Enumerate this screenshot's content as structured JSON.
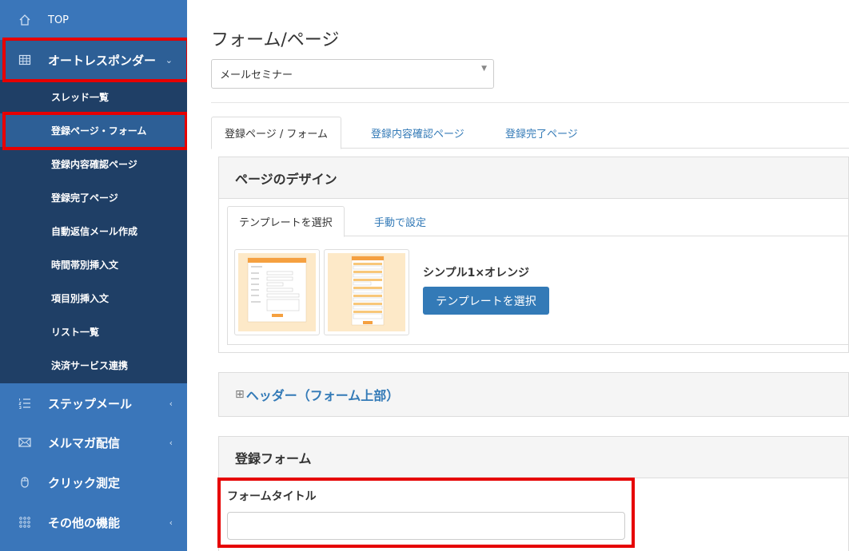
{
  "sidebar": {
    "top_label": "TOP",
    "autoresponder": "オートレスポンダー",
    "submenu": [
      "スレッド一覧",
      "登録ページ・フォーム",
      "登録内容確認ページ",
      "登録完了ページ",
      "自動返信メール作成",
      "時間帯別挿入文",
      "項目別挿入文",
      "リスト一覧",
      "決済サービス連携"
    ],
    "items": [
      {
        "label": "ステップメール",
        "icon": "list-icon"
      },
      {
        "label": "メルマガ配信",
        "icon": "envelope-icon"
      },
      {
        "label": "クリック測定",
        "icon": "mouse-icon"
      },
      {
        "label": "その他の機能",
        "icon": "grid-dots-icon"
      }
    ],
    "active_color": "#2d5f96",
    "bg_color": "#3a76ba"
  },
  "main": {
    "title": "フォーム/ページ",
    "select_value": "メールセミナー",
    "tabs": [
      "登録ページ / フォーム",
      "登録内容確認ページ",
      "登録完了ページ"
    ],
    "design": {
      "heading": "ページのデザイン",
      "inner_tabs": [
        "テンプレートを選択",
        "手動で設定"
      ],
      "template_name": "シンプル1×オレンジ",
      "select_button": "テンプレートを選択"
    },
    "header_section": {
      "plus": "⊞",
      "label": "ヘッダー（フォーム上部）"
    },
    "form_section": {
      "heading": "登録フォーム",
      "field_label": "フォームタイトル",
      "field_value": ""
    }
  },
  "accent_color": "#337ab7",
  "highlight_color": "#e60000"
}
